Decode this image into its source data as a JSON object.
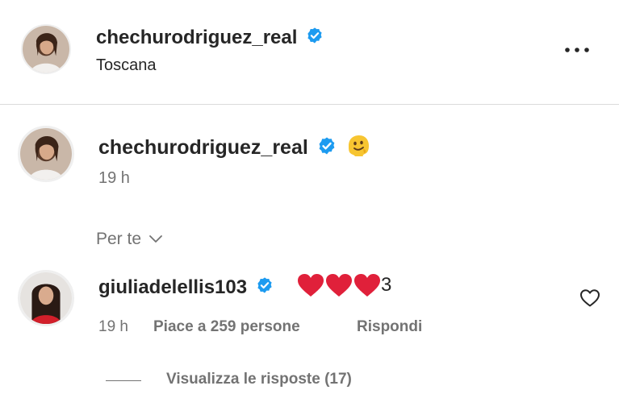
{
  "post_header": {
    "username": "chechurodriguez_real",
    "location": "Toscana",
    "more_icon": "more-horizontal-icon"
  },
  "caption": {
    "username": "chechurodriguez_real",
    "emoji": "🫠",
    "time": "19 h"
  },
  "sort": {
    "label": "Per te",
    "icon": "chevron-down-icon"
  },
  "comment": {
    "username": "giulia.delellis103",
    "username_display": "giuliadelellis103",
    "hearts": "❤❤❤",
    "text_suffix": "3",
    "time": "19 h",
    "likes": "Piace a 259 persone",
    "reply": "Rispondi",
    "like_icon": "heart-outline-icon",
    "heart_color": "#e0203a"
  },
  "replies": {
    "label": "Visualizza le risposte (17)"
  },
  "colors": {
    "verified": "#1d9bf0",
    "muted": "#737373",
    "divider": "#dbdbdb"
  }
}
